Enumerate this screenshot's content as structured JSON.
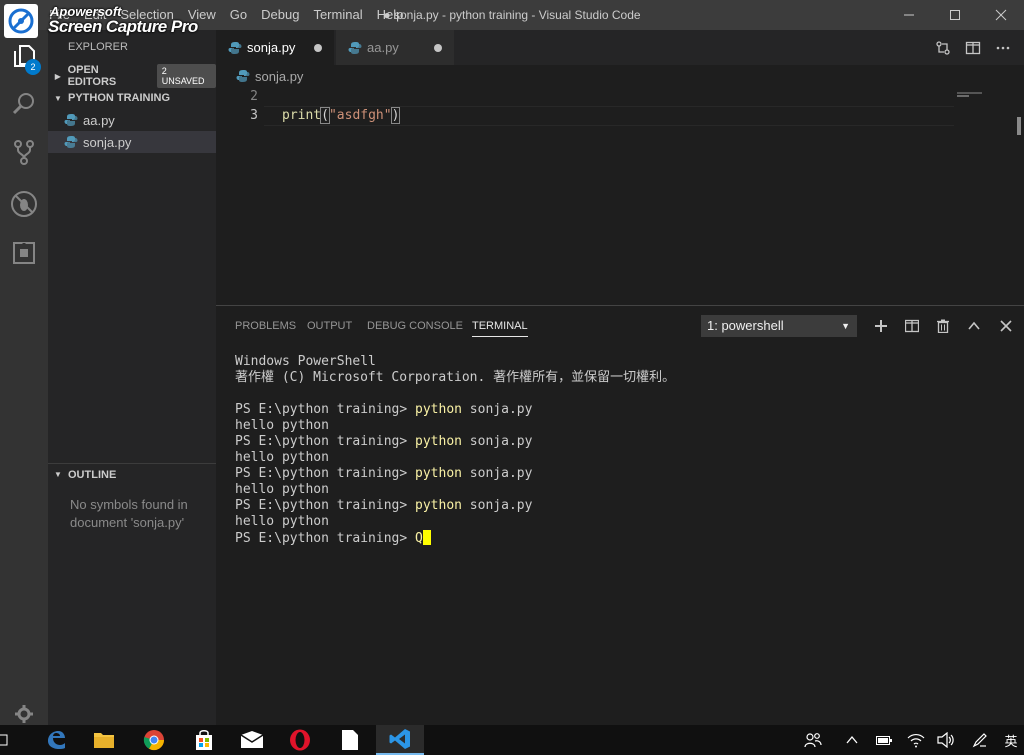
{
  "watermark": {
    "line1": "Apowersoft",
    "line2": "Screen Capture Pro"
  },
  "menu": [
    "File",
    "Edit",
    "Selection",
    "View",
    "Go",
    "Debug",
    "Terminal",
    "Help"
  ],
  "window_title": "● sonja.py - python training - Visual Studio Code",
  "activity": {
    "explorer_badge": "2"
  },
  "sidebar": {
    "title": "EXPLORER",
    "open_editors": "OPEN EDITORS",
    "unsaved_badge": "2 UNSAVED",
    "project": "PYTHON TRAINING",
    "files": [
      "aa.py",
      "sonja.py"
    ],
    "outline": "OUTLINE",
    "outline_message": "No symbols found in document 'sonja.py'"
  },
  "tabs": [
    {
      "label": "sonja.py",
      "active": true
    },
    {
      "label": "aa.py",
      "active": false
    }
  ],
  "breadcrumb": "sonja.py",
  "editor": {
    "line_numbers": [
      "2",
      "3"
    ],
    "code": {
      "fn": "print",
      "open": "(",
      "str": "\"asdfgh\"",
      "close": ")"
    }
  },
  "panel": {
    "tabs": [
      "PROBLEMS",
      "OUTPUT",
      "DEBUG CONSOLE",
      "TERMINAL"
    ],
    "active_tab": "TERMINAL",
    "terminal_select": "1: powershell"
  },
  "terminal": {
    "header1": "Windows PowerShell",
    "header2": "著作權 (C) Microsoft Corporation. 著作權所有，並保留一切權利。",
    "prompt": "PS E:\\python training> ",
    "cmd": "python",
    "args": " sonja.py",
    "output": "hello python",
    "cursor_char": "Q"
  },
  "taskbar": {
    "ime": "英"
  }
}
